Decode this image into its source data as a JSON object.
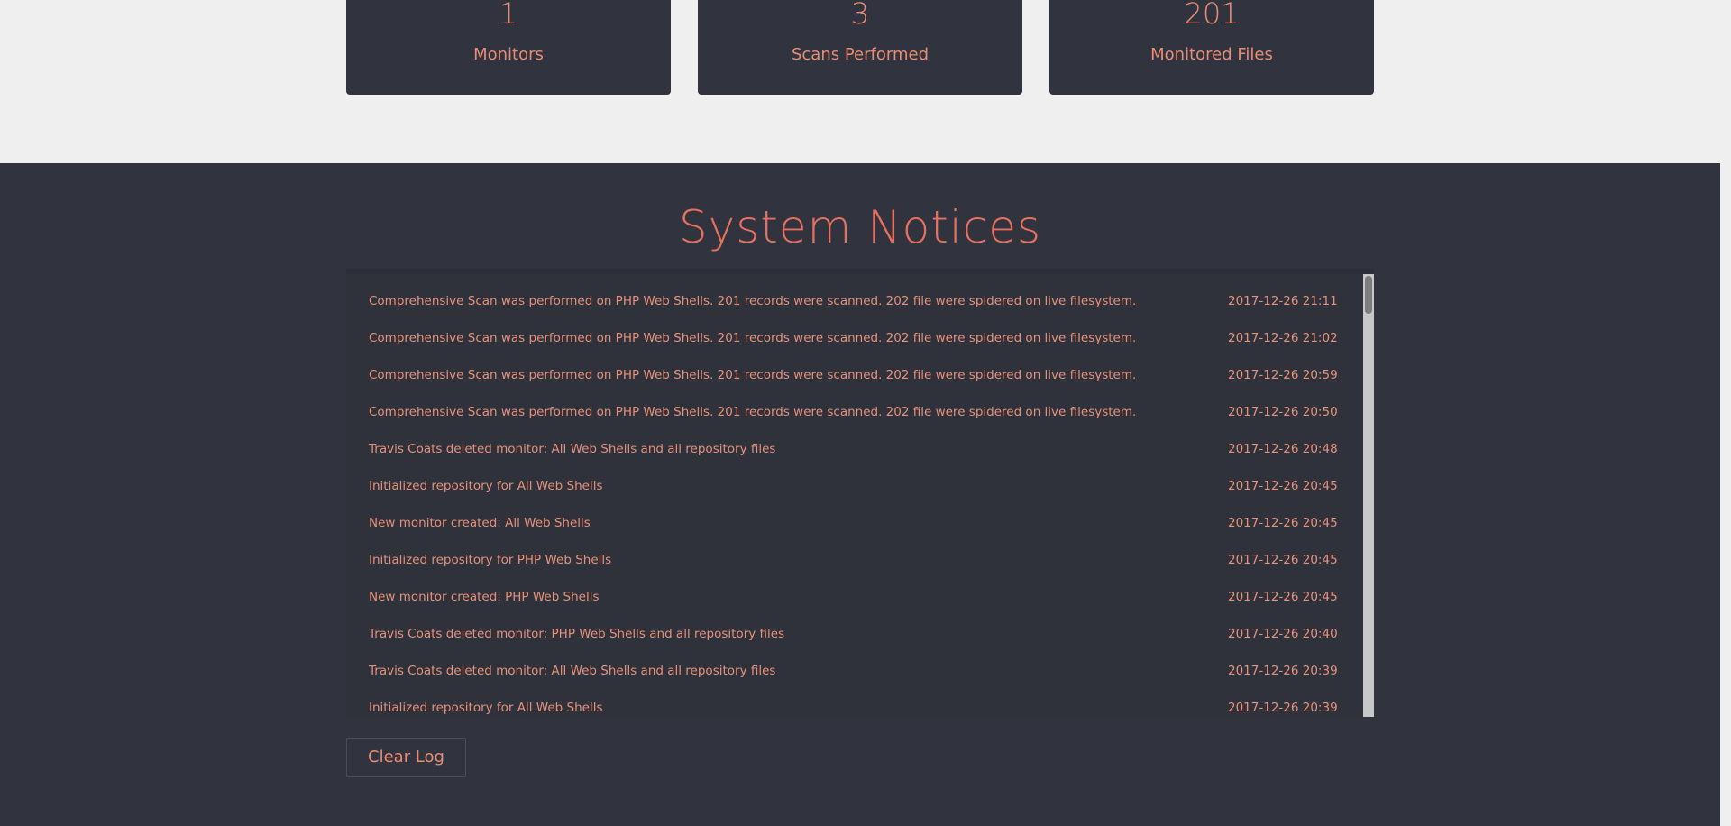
{
  "stats": [
    {
      "value": "1",
      "label": "Monitors"
    },
    {
      "value": "3",
      "label": "Scans Performed"
    },
    {
      "value": "201",
      "label": "Monitored Files"
    }
  ],
  "notices": {
    "title": "System Notices",
    "entries": [
      {
        "message": "Comprehensive Scan was performed on PHP Web Shells. 201 records were scanned. 202 file were spidered on live filesystem.",
        "time": "2017-12-26 21:11"
      },
      {
        "message": "Comprehensive Scan was performed on PHP Web Shells. 201 records were scanned. 202 file were spidered on live filesystem.",
        "time": "2017-12-26 21:02"
      },
      {
        "message": "Comprehensive Scan was performed on PHP Web Shells. 201 records were scanned. 202 file were spidered on live filesystem.",
        "time": "2017-12-26 20:59"
      },
      {
        "message": "Comprehensive Scan was performed on PHP Web Shells. 201 records were scanned. 202 file were spidered on live filesystem.",
        "time": "2017-12-26 20:50"
      },
      {
        "message": "Travis Coats deleted monitor: All Web Shells and all repository files",
        "time": "2017-12-26 20:48"
      },
      {
        "message": "Initialized repository for All Web Shells",
        "time": "2017-12-26 20:45"
      },
      {
        "message": "New monitor created: All Web Shells",
        "time": "2017-12-26 20:45"
      },
      {
        "message": "Initialized repository for PHP Web Shells",
        "time": "2017-12-26 20:45"
      },
      {
        "message": "New monitor created: PHP Web Shells",
        "time": "2017-12-26 20:45"
      },
      {
        "message": "Travis Coats deleted monitor: PHP Web Shells and all repository files",
        "time": "2017-12-26 20:40"
      },
      {
        "message": "Travis Coats deleted monitor: All Web Shells and all repository files",
        "time": "2017-12-26 20:39"
      },
      {
        "message": "Initialized repository for All Web Shells",
        "time": "2017-12-26 20:39"
      }
    ],
    "clear_label": "Clear Log"
  }
}
